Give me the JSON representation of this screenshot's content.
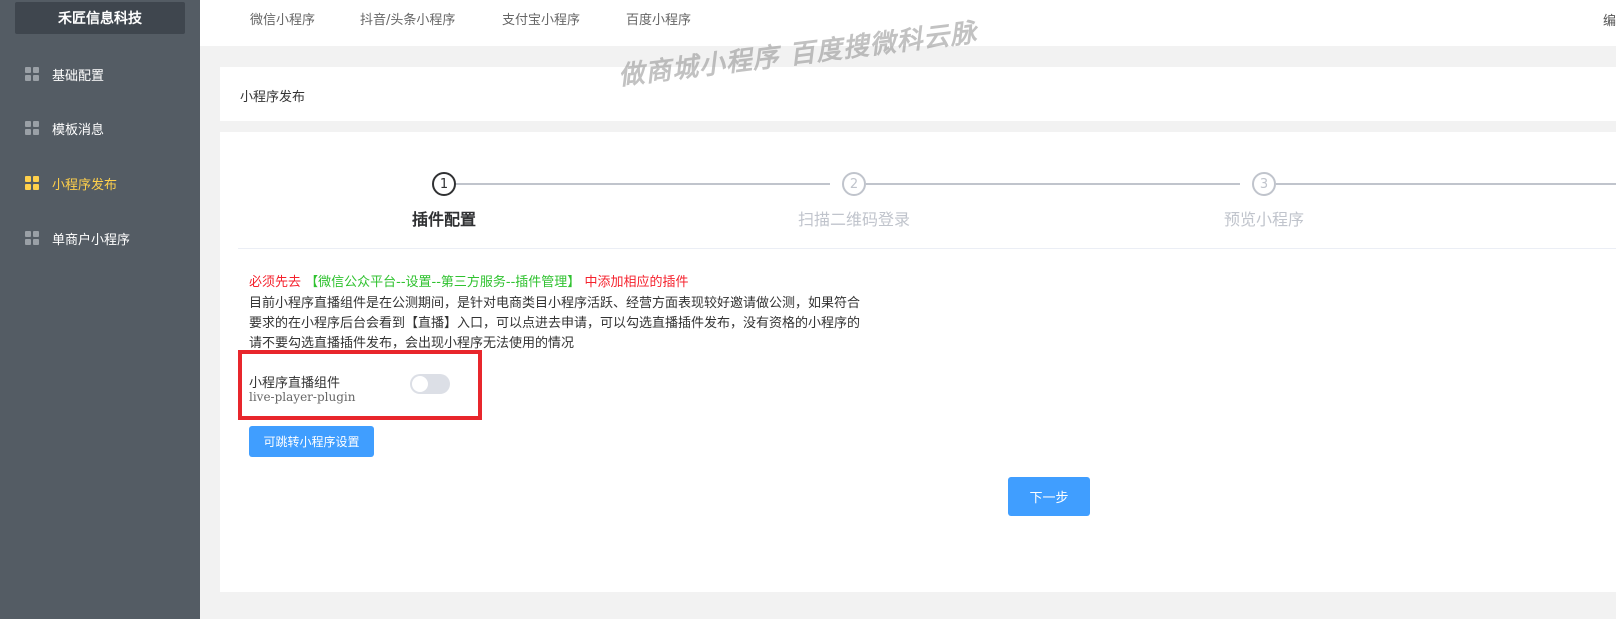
{
  "sidebar": {
    "brand": "禾匠信息科技",
    "items": [
      {
        "label": "基础配置",
        "active": false
      },
      {
        "label": "模板消息",
        "active": false
      },
      {
        "label": "小程序发布",
        "active": true
      },
      {
        "label": "单商户小程序",
        "active": false
      }
    ]
  },
  "topbar": {
    "tabs": [
      {
        "label": "微信小程序"
      },
      {
        "label": "抖音/头条小程序"
      },
      {
        "label": "支付宝小程序"
      },
      {
        "label": "百度小程序"
      }
    ],
    "right_partial": "编"
  },
  "header": {
    "title": "小程序发布"
  },
  "watermark": "做商城小程序 百度搜微科云脉",
  "steps": [
    {
      "number": "1",
      "title": "插件配置",
      "active": true
    },
    {
      "number": "2",
      "title": "扫描二维码登录",
      "active": false
    },
    {
      "number": "3",
      "title": "预览小程序",
      "active": false
    }
  ],
  "notice": {
    "prefix": "必须先去",
    "link": "【微信公众平台--设置--第三方服务--插件管理】",
    "suffix": "中添加相应的插件"
  },
  "description": "目前小程序直播组件是在公测期间，是针对电商类目小程序活跃、经营方面表现较好邀请做公测，如果符合要求的在小程序后台会看到【直播】入口，可以点进去申请，可以勾选直播插件发布，没有资格的小程序的请不要勾选直播插件发布，会出现小程序无法使用的情况",
  "plugin": {
    "label": "小程序直播组件",
    "id": "live-player-plugin",
    "enabled": false
  },
  "buttons": {
    "settings": "可跳转小程序设置",
    "next": "下一步"
  },
  "colors": {
    "sidebar_bg": "#545c64",
    "active_menu": "#ffd04b",
    "primary": "#409eff",
    "highlight_border": "#e8262c"
  }
}
